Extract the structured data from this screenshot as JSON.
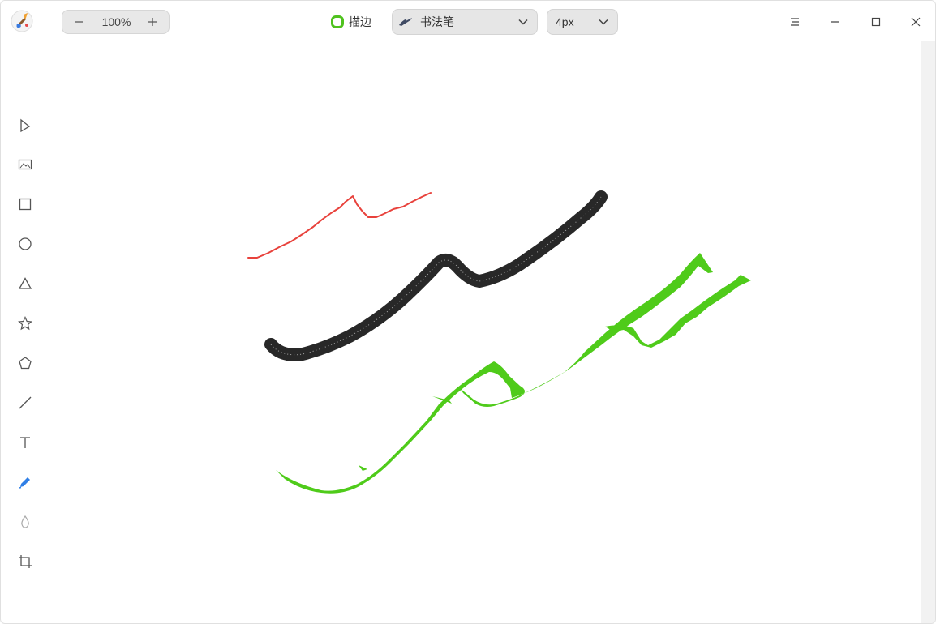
{
  "zoom": {
    "value": "100%"
  },
  "stroke": {
    "label": "描边",
    "color": "#4fc21e"
  },
  "brush": {
    "label": "书法笔",
    "icon": "calligraphy-pen-icon"
  },
  "size": {
    "label": "4px"
  },
  "tools": [
    "select-icon",
    "image-icon",
    "rectangle-icon",
    "ellipse-icon",
    "triangle-icon",
    "star-icon",
    "polygon-icon",
    "line-icon",
    "text-icon",
    "pen-icon",
    "blur-icon",
    "crop-icon"
  ],
  "active_tool": "pen-icon",
  "colors": {
    "accent": "#2f7fe6",
    "red_stroke": "#e8423c",
    "black_stroke": "#111111",
    "green_stroke": "#4fcb1a"
  }
}
